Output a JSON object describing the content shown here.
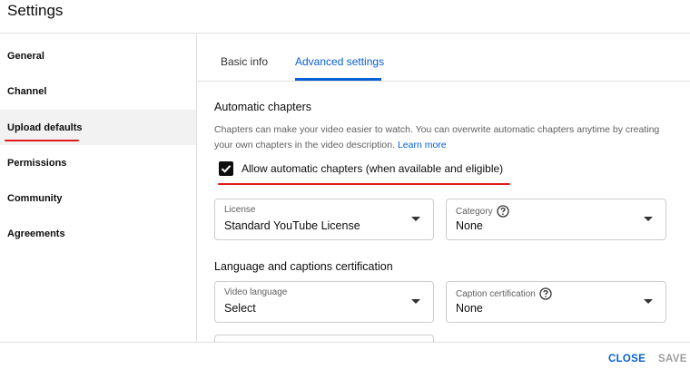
{
  "dialog": {
    "title": "Settings"
  },
  "sidebar": {
    "items": [
      {
        "label": "General"
      },
      {
        "label": "Channel"
      },
      {
        "label": "Upload defaults"
      },
      {
        "label": "Permissions"
      },
      {
        "label": "Community"
      },
      {
        "label": "Agreements"
      }
    ],
    "active": "Upload defaults"
  },
  "tabs": [
    {
      "label": "Basic info"
    },
    {
      "label": "Advanced settings"
    }
  ],
  "active_tab": "Advanced settings",
  "chapters": {
    "title": "Automatic chapters",
    "description": "Chapters can make your video easier to watch. You can overwrite automatic chapters anytime by creating your own chapters in the video description.",
    "learn_more": "Learn more",
    "checkbox_label": "Allow automatic chapters (when available and eligible)",
    "checked": true
  },
  "license": {
    "label": "License",
    "value": "Standard YouTube License"
  },
  "category": {
    "label": "Category",
    "value": "None"
  },
  "language_section": {
    "title": "Language and captions certification"
  },
  "video_language": {
    "label": "Video language",
    "value": "Select"
  },
  "caption_cert": {
    "label": "Caption certification",
    "value": "None"
  },
  "footer": {
    "close": "CLOSE",
    "save": "SAVE"
  },
  "colors": {
    "accent": "#065fd4",
    "highlight": "#e01a1a",
    "active_bg": "#f2f2f2"
  },
  "icons": {
    "checkbox": "checkmark-icon",
    "help": "help-circle-icon",
    "dropdown": "caret-down-icon"
  }
}
